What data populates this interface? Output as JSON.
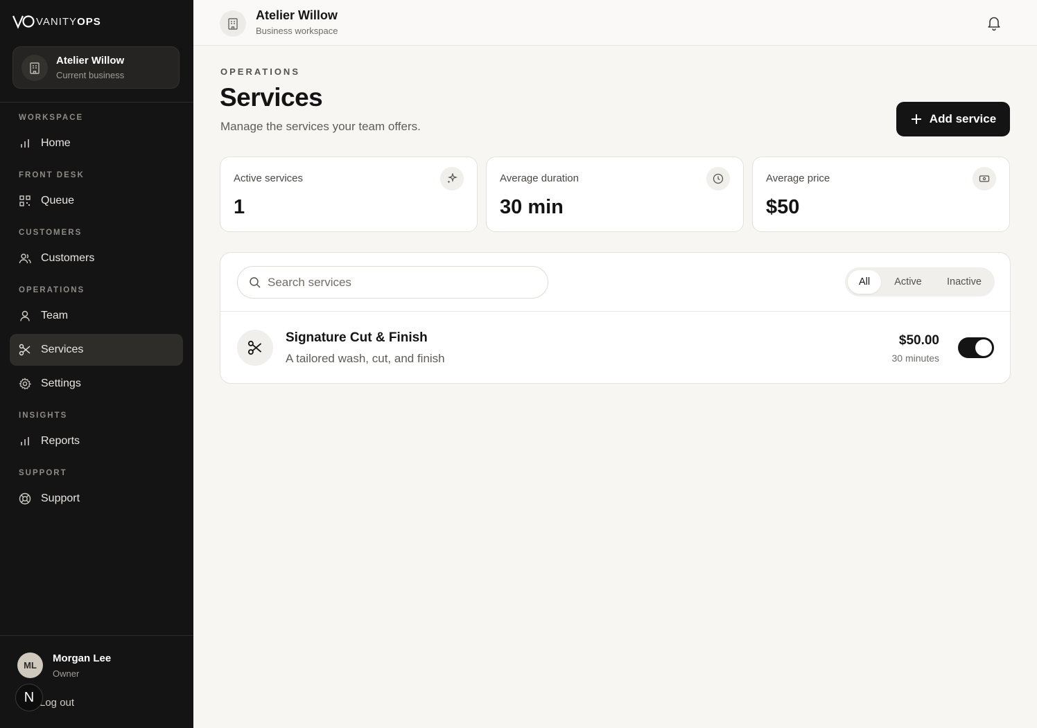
{
  "brand": {
    "logo_mark": "VO",
    "logo_thin": "VANITY",
    "logo_bold": "OPS"
  },
  "business_card": {
    "name": "Atelier Willow",
    "subtitle": "Current business",
    "icon": "building-icon"
  },
  "sidebar": {
    "sections": [
      {
        "label": "WORKSPACE",
        "items": [
          {
            "label": "Home",
            "icon": "bar-chart-icon",
            "active": false
          }
        ]
      },
      {
        "label": "FRONT DESK",
        "items": [
          {
            "label": "Queue",
            "icon": "qr-grid-icon",
            "active": false
          }
        ]
      },
      {
        "label": "CUSTOMERS",
        "items": [
          {
            "label": "Customers",
            "icon": "users-icon",
            "active": false
          }
        ]
      },
      {
        "label": "OPERATIONS",
        "items": [
          {
            "label": "Team",
            "icon": "user-icon",
            "active": false
          },
          {
            "label": "Services",
            "icon": "scissors-icon",
            "active": true
          },
          {
            "label": "Settings",
            "icon": "gear-icon",
            "active": false
          }
        ]
      },
      {
        "label": "INSIGHTS",
        "items": [
          {
            "label": "Reports",
            "icon": "bar-chart-icon",
            "active": false
          }
        ]
      },
      {
        "label": "SUPPORT",
        "items": [
          {
            "label": "Support",
            "icon": "lifebuoy-icon",
            "active": false
          }
        ]
      }
    ]
  },
  "user": {
    "initials": "ML",
    "name": "Morgan Lee",
    "role": "Owner",
    "logout_label": "Log out",
    "badge": "N"
  },
  "topbar": {
    "title": "Atelier Willow",
    "subtitle": "Business workspace"
  },
  "page": {
    "eyebrow": "OPERATIONS",
    "title": "Services",
    "description": "Manage the services your team offers.",
    "add_button_label": "Add service"
  },
  "stats": [
    {
      "label": "Active services",
      "value": "1",
      "icon": "sparkle-icon"
    },
    {
      "label": "Average duration",
      "value": "30 min",
      "icon": "clock-icon"
    },
    {
      "label": "Average price",
      "value": "$50",
      "icon": "banknote-icon"
    }
  ],
  "list": {
    "search_placeholder": "Search services",
    "filters": [
      {
        "label": "All",
        "selected": true
      },
      {
        "label": "Active",
        "selected": false
      },
      {
        "label": "Inactive",
        "selected": false
      }
    ],
    "services": [
      {
        "name": "Signature Cut & Finish",
        "description": "A tailored wash, cut, and finish",
        "price": "$50.00",
        "duration": "30 minutes",
        "enabled": true
      }
    ]
  },
  "colors": {
    "sidebar_bg": "#141414",
    "page_bg": "#f7f6f3",
    "accent": "#141414"
  }
}
